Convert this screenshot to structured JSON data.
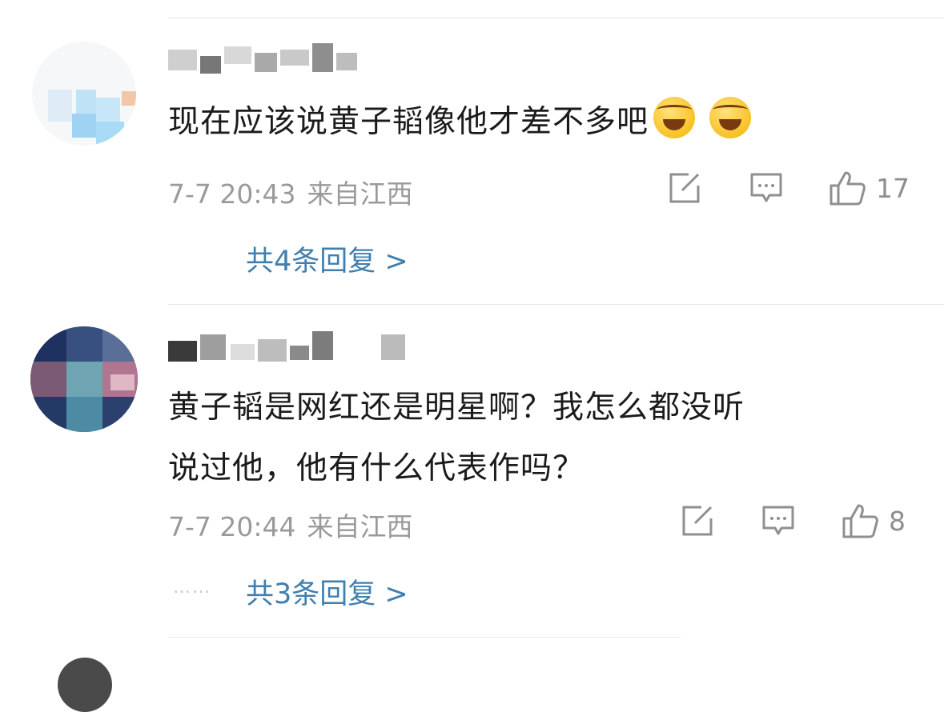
{
  "comments": [
    {
      "text_line1": "现在应该说黄子韬像他才差不多吧",
      "emoji_1": "laugh-cry-emoji",
      "emoji_2": "laugh-cry-emoji",
      "time": "7-7 20:43",
      "location": "来自江西",
      "like_count": "17",
      "replies": "共4条回复 >"
    },
    {
      "text_line1": "黄子韬是网红还是明星啊？我怎么都没听",
      "text_line2": "说过他，他有什么代表作吗？",
      "time": "7-7 20:44",
      "location": "来自江西",
      "like_count": "8",
      "dots": "……",
      "replies": "共3条回复 >"
    }
  ],
  "icons": {
    "share": "share-edit-icon",
    "comment": "comment-icon",
    "like": "thumbs-up-icon"
  },
  "colors": {
    "reply_link": "#3f7fb0",
    "meta_gray": "#9a9a9a",
    "divider": "#e8e8e8"
  }
}
